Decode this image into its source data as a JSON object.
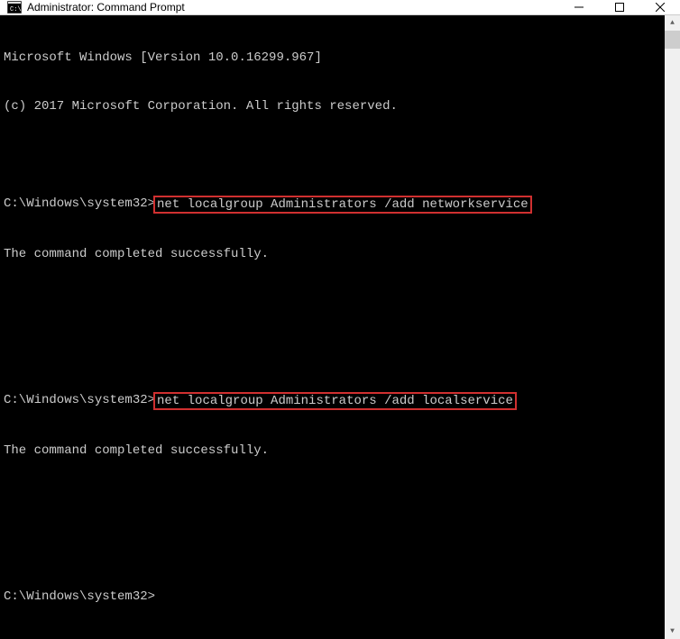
{
  "window": {
    "title": "Administrator: Command Prompt"
  },
  "terminal": {
    "line1": "Microsoft Windows [Version 10.0.16299.967]",
    "line2": "(c) 2017 Microsoft Corporation. All rights reserved.",
    "prompt1": "C:\\Windows\\system32>",
    "cmd1": "net localgroup Administrators /add networkservice",
    "result1": "The command completed successfully.",
    "prompt2": "C:\\Windows\\system32>",
    "cmd2": "net localgroup Administrators /add localservice",
    "result2": "The command completed successfully.",
    "prompt3": "C:\\Windows\\system32>"
  }
}
